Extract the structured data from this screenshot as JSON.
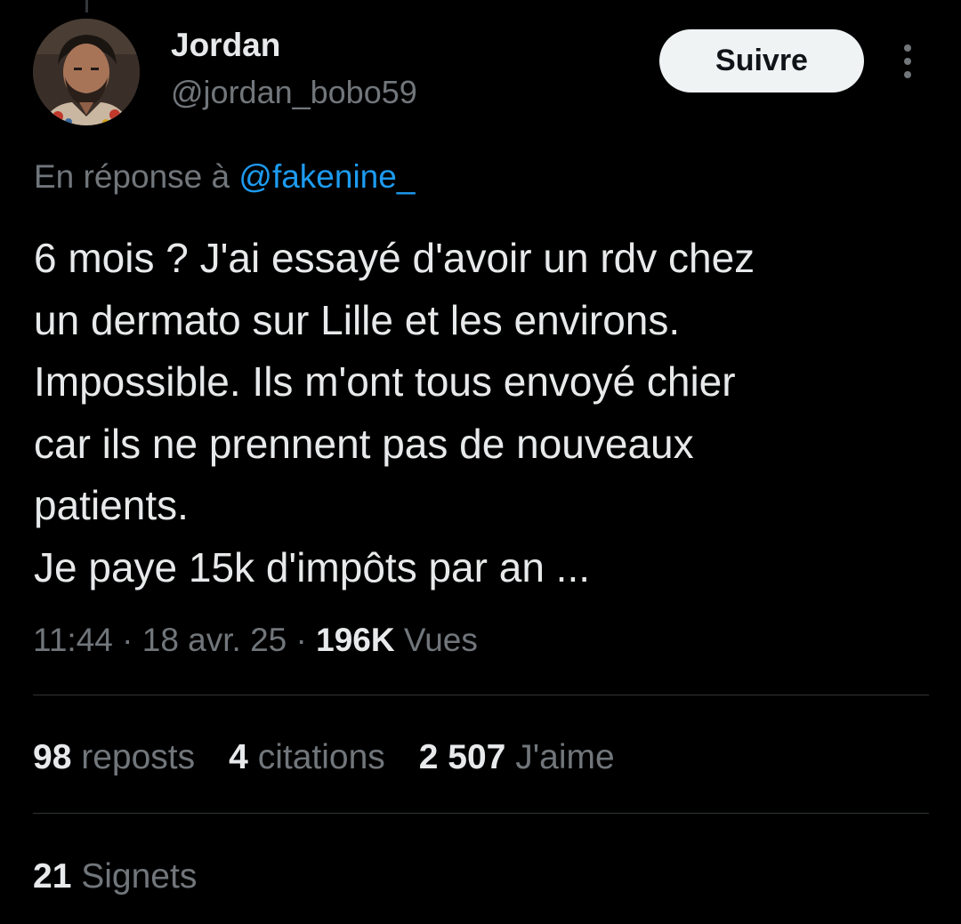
{
  "author": {
    "display_name": "Jordan",
    "handle": "@jordan_bobo59",
    "avatar_icon": "avatar-photo"
  },
  "follow_button": {
    "label": "Suivre"
  },
  "more_menu": {
    "icon": "more-vertical-icon"
  },
  "reply": {
    "prefix": "En réponse à",
    "mention": "@fakenine_"
  },
  "tweet": {
    "lines": [
      "6 mois ? J'ai essayé d'avoir un rdv chez",
      "un dermato sur Lille et les environs.",
      "Impossible. Ils m'ont tous envoyé chier",
      "car ils ne prennent pas de nouveaux",
      "patients.",
      "Je paye 15k d'impôts par an ..."
    ]
  },
  "meta": {
    "time": "11:44",
    "separator": "·",
    "date": "18 avr. 25",
    "views_count": "196K",
    "views_label": "Vues"
  },
  "stats": {
    "reposts_count": "98",
    "reposts_label": "reposts",
    "quotes_count": "4",
    "quotes_label": "citations",
    "likes_count": "2 507",
    "likes_label": "J'aime",
    "bookmarks_count": "21",
    "bookmarks_label": "Signets"
  },
  "colors": {
    "background": "#000000",
    "primary_text": "#e7e9ea",
    "secondary_text": "#71767b",
    "link": "#1d9bf0",
    "button_bg": "#eff3f4",
    "divider": "#2f3336"
  }
}
